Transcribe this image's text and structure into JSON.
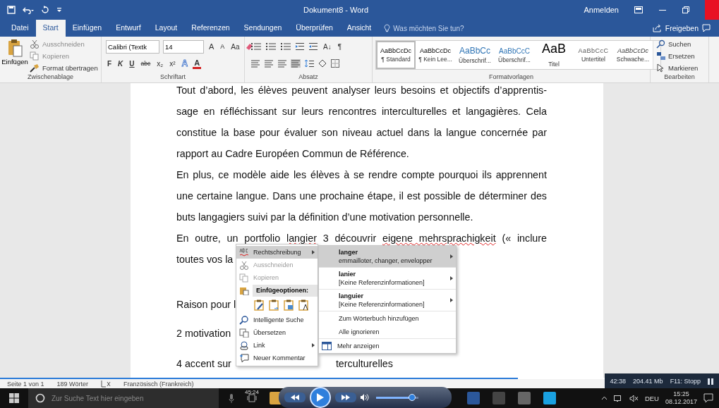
{
  "window": {
    "title": "Dokument8 - Word",
    "account": "Anmelden"
  },
  "tabs": [
    {
      "label": "Datei",
      "selected": false
    },
    {
      "label": "Start",
      "selected": true
    },
    {
      "label": "Einfügen",
      "selected": false
    },
    {
      "label": "Entwurf",
      "selected": false
    },
    {
      "label": "Layout",
      "selected": false
    },
    {
      "label": "Referenzen",
      "selected": false
    },
    {
      "label": "Sendungen",
      "selected": false
    },
    {
      "label": "Überprüfen",
      "selected": false
    },
    {
      "label": "Ansicht",
      "selected": false
    }
  ],
  "tell_me": {
    "placeholder": "Was möchten Sie tun?"
  },
  "share": "Freigeben",
  "clipboard": {
    "paste": "Einfügen",
    "items": [
      "Ausschneiden",
      "Kopieren",
      "Format übertragen"
    ],
    "label": "Zwischenablage"
  },
  "font": {
    "name": "Calibri (Textk",
    "size": "14",
    "size_buttons": [
      "A",
      "A"
    ],
    "case_button": "Aa",
    "format_buttons": [
      "F",
      "K",
      "U",
      "abc",
      "x₂",
      "x²"
    ],
    "effect_buttons": [
      "A",
      "A"
    ],
    "label": "Schriftart"
  },
  "paragraph": {
    "sort": "A↓",
    "marks": "¶",
    "label": "Absatz"
  },
  "styles": {
    "label": "Formatvorlagen",
    "items": [
      {
        "preview": "AaBbCcDc",
        "name": "¶ Standard",
        "kind": "normal",
        "selected": true
      },
      {
        "preview": "AaBbCcDc",
        "name": "¶ Kein Lee...",
        "kind": "normal",
        "selected": false
      },
      {
        "preview": "AaBbCc",
        "name": "Überschrif...",
        "kind": "heading1",
        "selected": false
      },
      {
        "preview": "AaBbCcC",
        "name": "Überschrif...",
        "kind": "heading2",
        "selected": false
      },
      {
        "preview": "AaB",
        "name": "Titel",
        "kind": "title",
        "selected": false
      },
      {
        "preview": "AaBbCcC",
        "name": "Untertitel",
        "kind": "subtitle",
        "selected": false
      },
      {
        "preview": "AaBbCcDc",
        "name": "Schwache...",
        "kind": "emphasis",
        "selected": false
      }
    ]
  },
  "editing": {
    "label": "Bearbeiten",
    "items": [
      "Suchen",
      "Ersetzen",
      "Markieren"
    ]
  },
  "document": {
    "lines": [
      {
        "kind": "body",
        "segments": [
          {
            "text": "Tout d’abord, les élèves peuvent analyser leurs besoins et objectifs d’apprentis-",
            "misspelled": false
          }
        ]
      },
      {
        "kind": "body",
        "segments": [
          {
            "text": "sage en réfléchissant sur leurs rencontres interculturelles et langagières. Cela",
            "misspelled": false
          }
        ]
      },
      {
        "kind": "body",
        "segments": [
          {
            "text": "constitue la base pour évaluer son niveau actuel dans la langue concernée par",
            "misspelled": false
          }
        ]
      },
      {
        "kind": "last",
        "segments": [
          {
            "text": "rapport au Cadre Européen Commun de Référence.",
            "misspelled": false
          }
        ]
      },
      {
        "kind": "body",
        "segments": [
          {
            "text": "En plus, ce modèle aide les élèves à se rendre compte pourquoi ils apprennent",
            "misspelled": false
          }
        ]
      },
      {
        "kind": "body",
        "segments": [
          {
            "text": "une certaine langue. Dans une prochaine étape, il est possible de déterminer des",
            "misspelled": false
          }
        ]
      },
      {
        "kind": "last",
        "segments": [
          {
            "text": "buts langagiers suivi par la définition d’une motivation personnelle.",
            "misspelled": false
          }
        ]
      },
      {
        "kind": "body",
        "segments": [
          {
            "text": "En outre, un portfolio ",
            "misspelled": false
          },
          {
            "text": "langier",
            "misspelled": true
          },
          {
            "text": " 3 découvrir ",
            "misspelled": false
          },
          {
            "text": "eigene",
            "misspelled": true
          },
          {
            "text": " mehrsprachigkeit",
            "misspelled": true
          },
          {
            "text": " (« inclure",
            "misspelled": false
          }
        ]
      },
      {
        "kind": "last",
        "segments": [
          {
            "text": "toutes vos la",
            "misspelled": false
          }
        ]
      },
      {
        "kind": "after-gap",
        "segments": [
          {
            "text": "Raison pour l",
            "misspelled": false
          }
        ]
      },
      {
        "kind": "spaced",
        "segments": [
          {
            "text": "2 motivation",
            "misspelled": false
          }
        ]
      },
      {
        "kind": "split",
        "segments": [
          {
            "text": "4 accent sur",
            "misspelled": false
          },
          {
            "text": "terculturelles",
            "misspelled": false
          }
        ]
      }
    ]
  },
  "context_menu": {
    "items": [
      {
        "kind": "item",
        "label": "Rechtschreibung",
        "selected": true,
        "disabled": false,
        "submenu": true
      },
      {
        "kind": "item",
        "label": "Ausschneiden",
        "selected": false,
        "disabled": true,
        "submenu": false
      },
      {
        "kind": "item",
        "label": "Kopieren",
        "selected": false,
        "disabled": true,
        "submenu": false
      },
      {
        "kind": "header",
        "label": "Einfügeoptionen:"
      },
      {
        "kind": "paste-options"
      },
      {
        "kind": "item",
        "label": "Intelligente Suche",
        "selected": false,
        "disabled": false,
        "submenu": false
      },
      {
        "kind": "item",
        "label": "Übersetzen",
        "selected": false,
        "disabled": false,
        "submenu": false
      },
      {
        "kind": "item",
        "label": "Link",
        "selected": false,
        "disabled": false,
        "submenu": true
      },
      {
        "kind": "item",
        "label": "Neuer Kommentar",
        "selected": false,
        "disabled": false,
        "submenu": false
      }
    ]
  },
  "spelling_menu": {
    "items": [
      {
        "kind": "suggestion",
        "word": "langer",
        "detail": "emmailloter, changer, envelopper",
        "selected": true
      },
      {
        "kind": "suggestion",
        "word": "lanier",
        "detail": "[Keine Referenzinformationen]",
        "selected": false
      },
      {
        "kind": "suggestion",
        "word": "languier",
        "detail": "[Keine Referenzinformationen]",
        "selected": false
      },
      {
        "kind": "action",
        "label": "Zum Wörterbuch hinzufügen"
      },
      {
        "kind": "action",
        "label": "Alle ignorieren"
      },
      {
        "kind": "more",
        "label": "Mehr anzeigen"
      }
    ]
  },
  "status_bar": {
    "page": "Seite 1 von 1",
    "words": "189 Wörter",
    "language": "Französisch (Frankreich)"
  },
  "recorder": {
    "time": "42:38",
    "size": "204.41 Mb",
    "stop": "F11: Stopp"
  },
  "media_player": {
    "progress": {
      "level": 0.72
    },
    "volume": {
      "level": 0.85
    },
    "elapsed": "45:24"
  },
  "taskbar": {
    "search": {
      "placeholder": "Zur Suche Text hier eingeben"
    },
    "language": "DEU",
    "time": "15:25",
    "date": "08.12.2017"
  }
}
